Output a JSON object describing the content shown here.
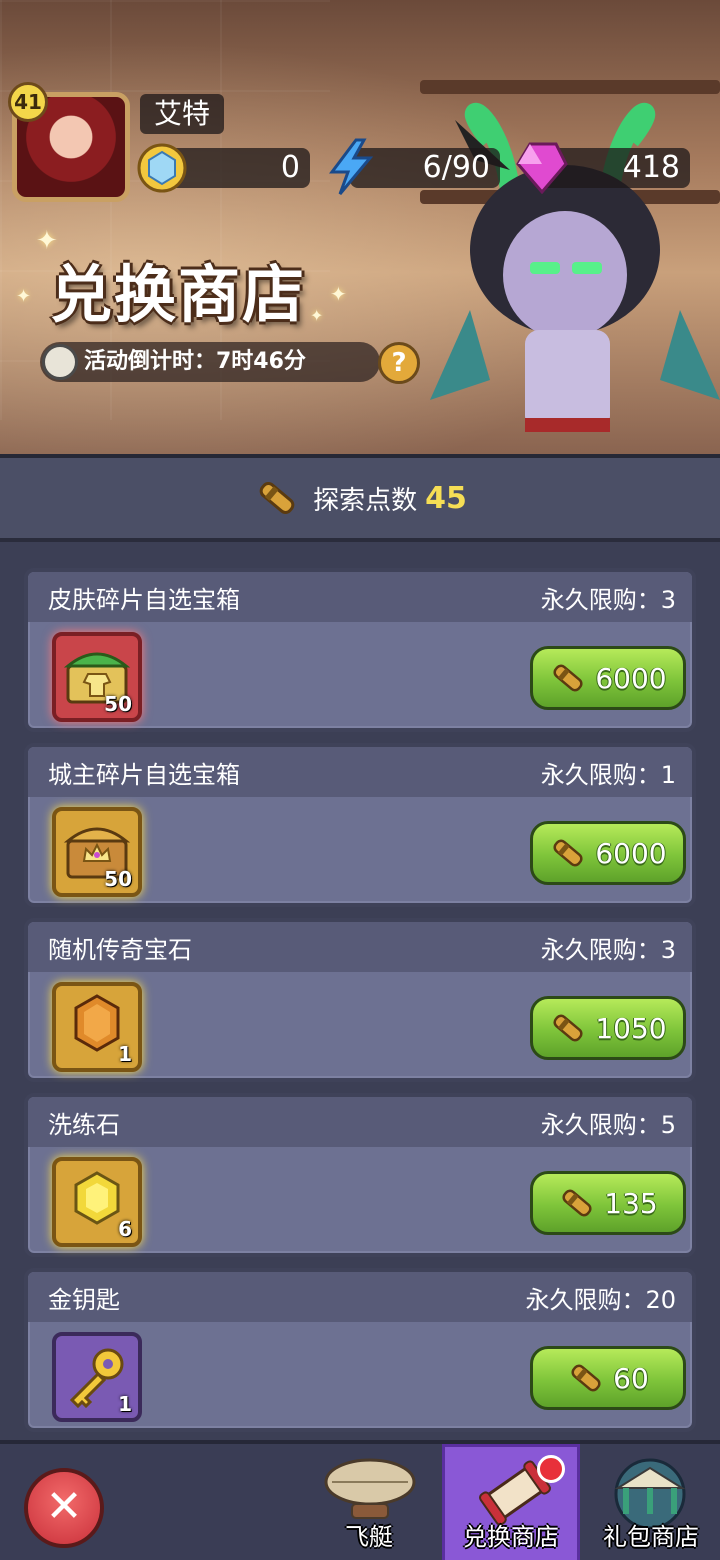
{
  "player": {
    "level": "41",
    "name": "艾特"
  },
  "resources": {
    "coins": "0",
    "energy": "6/90",
    "gems": "418"
  },
  "shop": {
    "title": "兑换商店",
    "countdown_label": "活动倒计时：7时46分",
    "help_label": "?"
  },
  "points": {
    "label": "探索点数",
    "value": "45"
  },
  "items": [
    {
      "name": "皮肤碎片自选宝箱",
      "limit": "永久限购：3",
      "count": "50",
      "price": "6000",
      "icon": "skin-chest-icon",
      "rarity": "red"
    },
    {
      "name": "城主碎片自选宝箱",
      "limit": "永久限购：1",
      "count": "50",
      "price": "6000",
      "icon": "lord-chest-icon",
      "rarity": "gold"
    },
    {
      "name": "随机传奇宝石",
      "limit": "永久限购：3",
      "count": "1",
      "price": "1050",
      "icon": "legendary-gem-icon",
      "rarity": "gold"
    },
    {
      "name": "洗练石",
      "limit": "永久限购：5",
      "count": "6",
      "price": "135",
      "icon": "refine-stone-icon",
      "rarity": "gold"
    },
    {
      "name": "金钥匙",
      "limit": "永久限购：20",
      "count": "1",
      "price": "60",
      "icon": "gold-key-icon",
      "rarity": "purple"
    }
  ],
  "nav": {
    "close_label": "✕",
    "tabs": [
      {
        "label": "飞艇",
        "icon": "airship-icon",
        "active": false
      },
      {
        "label": "兑换商店",
        "icon": "scroll-icon",
        "active": true
      },
      {
        "label": "礼包商店",
        "icon": "gift-tent-icon",
        "active": false
      }
    ]
  },
  "colors": {
    "accent_green": "#7ec43a",
    "points_yellow": "#f6de55",
    "tab_active": "#8a58d6"
  }
}
